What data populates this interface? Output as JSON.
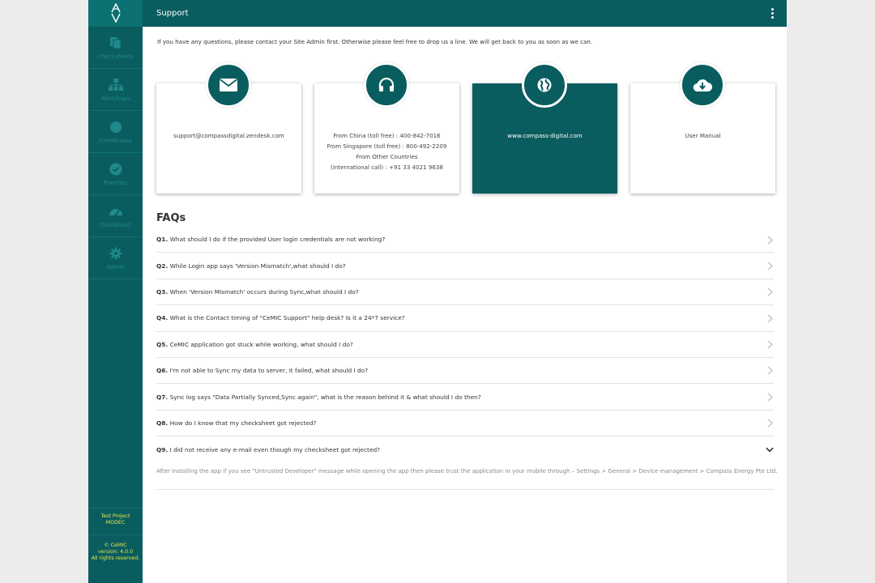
{
  "header": {
    "title": "Support"
  },
  "sidebar": {
    "items": [
      {
        "label": "Checksheets",
        "icon": "checksheets-icon"
      },
      {
        "label": "Workflows",
        "icon": "workflow-icon"
      },
      {
        "label": "Certificates",
        "icon": "certificate-icon"
      },
      {
        "label": "Punches",
        "icon": "punch-check-icon"
      },
      {
        "label": "Dashboard",
        "icon": "dashboard-gauge-icon"
      },
      {
        "label": "Admin",
        "icon": "gear-icon"
      }
    ],
    "project_line1": "Test Project",
    "project_line2": "MODEC",
    "copyright_line1": "© CeMIC",
    "copyright_line2": "version: 4.0.0",
    "copyright_line3": "All rights reserved."
  },
  "intro": "If you have any questions, please contact your Site Admin first. Otherwise please feel free to drop us a line. We will get back to you as soon as we can.",
  "contacts": [
    {
      "icon": "envelope-icon",
      "lines": [
        "support@compassdigital.zendesk.com"
      ]
    },
    {
      "icon": "headphones-icon",
      "lines": [
        "From China (toll free) : 400-842-7016",
        "From Singapore (toll free) : 800-492-2209",
        "From Other Countries",
        "(international call) : +91 33 4021 9638"
      ]
    },
    {
      "icon": "globe-icon",
      "lines": [
        "www.compass-digital.com"
      ]
    },
    {
      "icon": "cloud-download-icon",
      "lines": [
        "User Manual"
      ]
    }
  ],
  "faq": {
    "title": "FAQs",
    "items": [
      {
        "num": "Q1.",
        "text": "What should I do if the provided User login credentials are not working?"
      },
      {
        "num": "Q2.",
        "text": "While Login app says 'Version Mismatch',what should I do?"
      },
      {
        "num": "Q3.",
        "text": "When 'Version Mismatch' occurs during Sync,what should I do?"
      },
      {
        "num": "Q4.",
        "text": "What is the Contact timing of \"CeMIC Support\" help desk? Is it a 24*7 service?"
      },
      {
        "num": "Q5.",
        "text": "CeMIC application got stuck while working, what should I do?"
      },
      {
        "num": "Q6.",
        "text": "I'm not able to Sync my data to server, it failed, what should I do?"
      },
      {
        "num": "Q7.",
        "text": "Sync log says \"Data Partially Synced,Sync again\", what is the reason behind it & what should I do then?"
      },
      {
        "num": "Q8.",
        "text": "How do I know that my checksheet got rejected?"
      },
      {
        "num": "Q9.",
        "text": "I did not receive any e-mail even though my checksheet got rejected?"
      }
    ],
    "expanded_answer": "After installing the app if you see \"Untrusted Developer\" message while opening the app then please trust the application in your mobile through – Settings > General > Device management > Compass Energy Pte Ltd."
  },
  "colors": {
    "primary": "#0a5d5f",
    "sidebar_label": "#1f8a8b",
    "footer_text": "#e8e64a"
  }
}
